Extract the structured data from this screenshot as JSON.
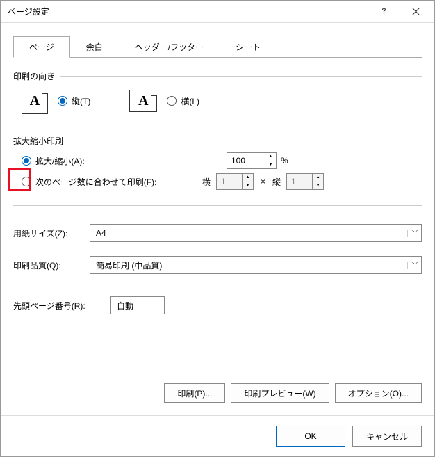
{
  "title": "ページ設定",
  "tabs": [
    "ページ",
    "余白",
    "ヘッダー/フッター",
    "シート"
  ],
  "activeTab": 0,
  "orientation": {
    "label": "印刷の向き",
    "portrait": "縦(T)",
    "landscape": "横(L)",
    "selected": "portrait"
  },
  "scaling": {
    "label": "拡大縮小印刷",
    "adjust": {
      "label": "拡大/縮小(A):",
      "value": "100",
      "suffix": "%"
    },
    "fit": {
      "label": "次のページ数に合わせて印刷(F):",
      "wideLabel": "横",
      "wide": "1",
      "sep": "×",
      "tallLabel": "縦",
      "tall": "1"
    },
    "selected": "adjust"
  },
  "paperSize": {
    "label": "用紙サイズ(Z):",
    "value": "A4"
  },
  "printQuality": {
    "label": "印刷品質(Q):",
    "value": "簡易印刷 (中品質)"
  },
  "firstPage": {
    "label": "先頭ページ番号(R):",
    "value": "自動"
  },
  "buttons": {
    "print": "印刷(P)...",
    "preview": "印刷プレビュー(W)",
    "options": "オプション(O)...",
    "ok": "OK",
    "cancel": "キャンセル"
  }
}
